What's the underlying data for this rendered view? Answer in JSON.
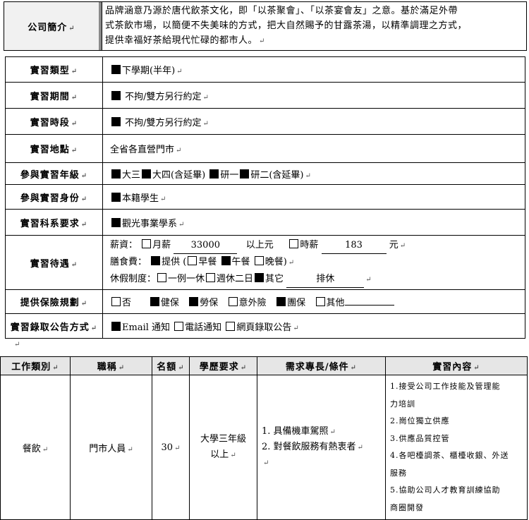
{
  "intro": {
    "label": "公司簡介",
    "text_line1": "品牌涵意乃源於唐代飲茶文化，即「以茶聚會」、「以茶宴會友」之意。基於滿足外帶",
    "text_line2": "式茶飲市場，以簡便不失美味的方式，把大自然賜予的甘露茶湯，以精準調理之方式，",
    "text_line3": "提供幸福好茶給現代忙碌的都市人。"
  },
  "info": {
    "type_label": "實習類型",
    "type_value": "下學期(半年)",
    "period_label": "實習期間",
    "period_value": " 不拘/雙方另行約定",
    "hours_label": "實習時段",
    "hours_value": " 不拘/雙方另行約定",
    "location_label": "實習地點",
    "location_value": "全省各直營門市",
    "grade_label": "參與實習年級",
    "grade_opts": [
      "大三",
      "大四(含延畢)",
      "研一",
      "研二(含延畢)"
    ],
    "identity_label": "參與實習身份",
    "identity_value": "本籍學生",
    "dept_label": "實習科系要求",
    "dept_value": "觀光事業學系",
    "pay_label": "實習待遇",
    "salary_label": "薪資：",
    "monthly_label": "月薪",
    "monthly_value": "33000",
    "above_text": "以上元",
    "hourly_label": "時薪",
    "hourly_value": "183",
    "yuan": "元",
    "meal_label": "膳食費：",
    "meal_provide": "提供 (",
    "meal_opts": [
      "早餐",
      "午餐",
      "晚餐)"
    ],
    "leave_label": "休假制度：",
    "leave_opts": [
      "一例一休",
      "週休二日",
      "其它"
    ],
    "leave_other": "排休",
    "ins_label": "提供保險規劃",
    "ins_opts": [
      "否",
      "健保",
      "勞保",
      "意外險",
      "團保",
      "其他"
    ],
    "notice_label": "實習錄取公告方式",
    "notice_opts": [
      "Email 通知",
      "電話通知",
      "網頁錄取公告"
    ]
  },
  "jobs": {
    "headers": [
      "工作類別",
      "職稱",
      "名額",
      "學歷要求",
      "需求專長/條件",
      "實習內容"
    ],
    "category": "餐飲",
    "title": "門市人員",
    "quota": "30",
    "edu_line1": "大學三年級",
    "edu_line2": "以上",
    "req_line1": "1. 具備機車駕照",
    "req_line2": "2. 對餐飲服務有熱衷者",
    "content_lines": [
      "1.接受公司工作技能及管理能",
      "力培訓",
      "2.崗位獨立供應",
      "3.供應品質控管",
      "4.各吧檯調茶、櫃檯收銀、外送",
      "服務",
      "5.協助公司人才教育訓練協助",
      "商圈開發"
    ]
  }
}
